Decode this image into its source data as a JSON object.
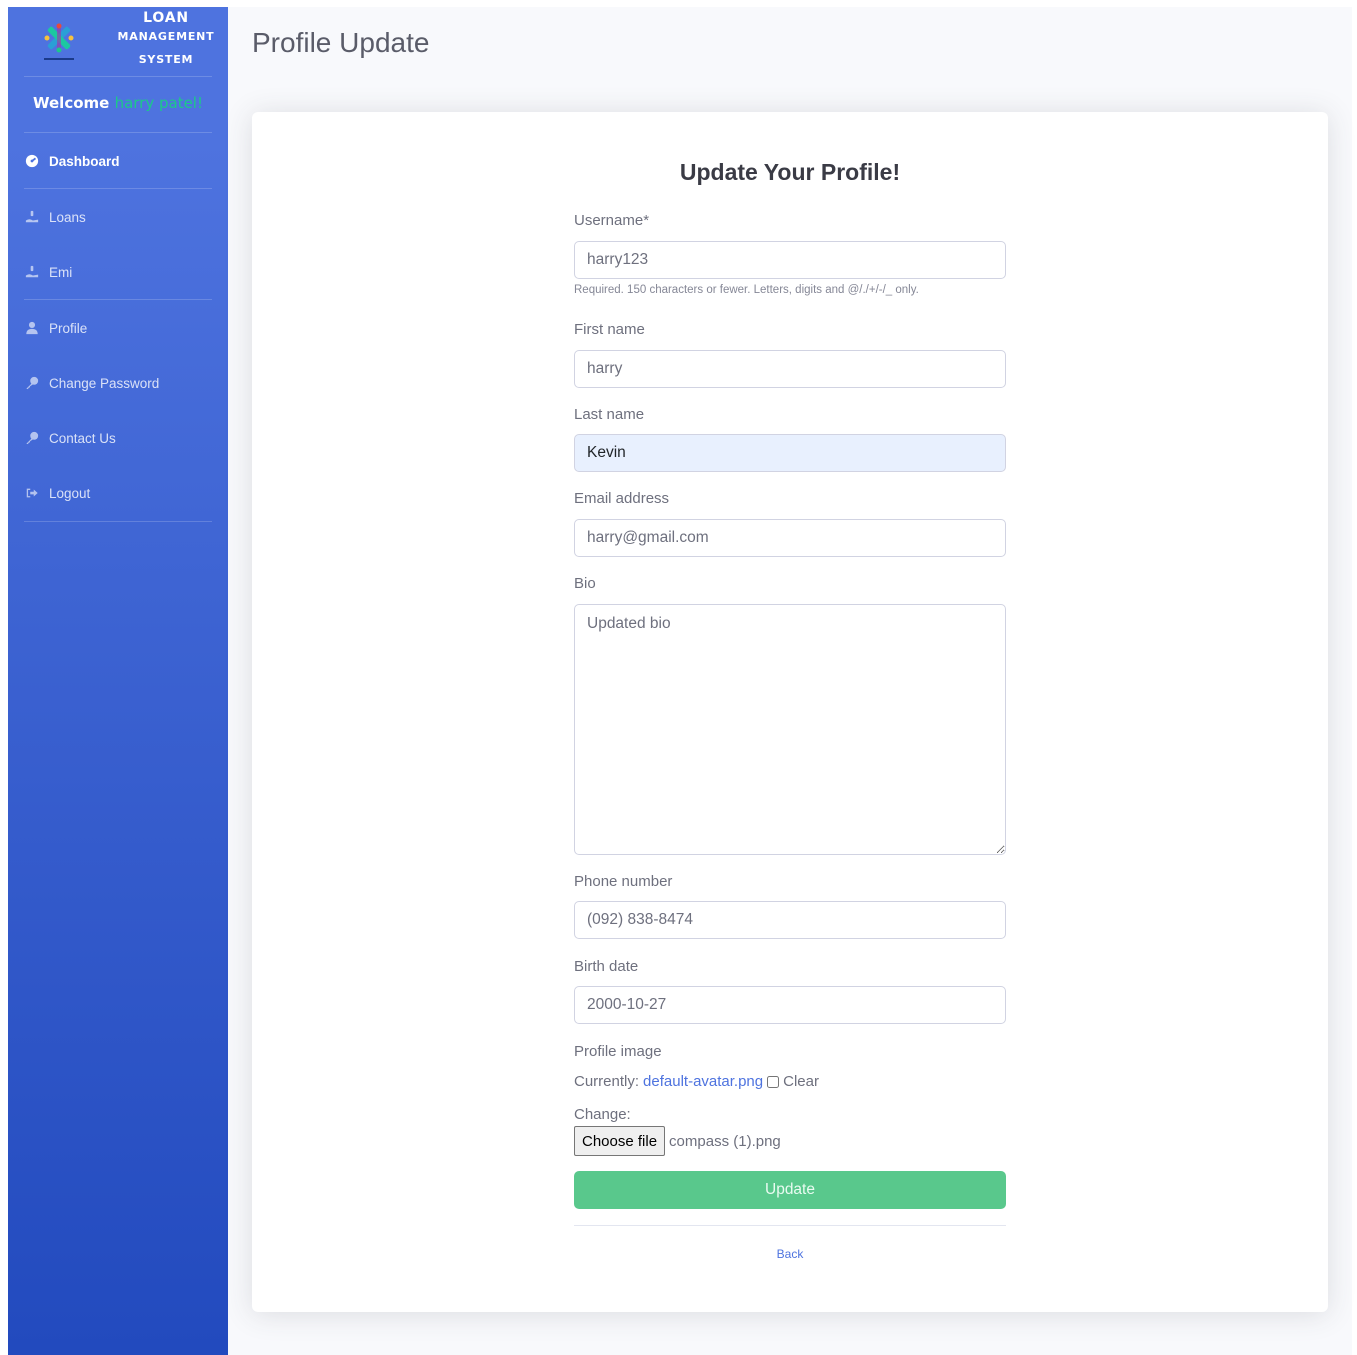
{
  "brand": {
    "line1": "LOAN",
    "line2": "MANAGEMENT",
    "line3": "SYSTEM",
    "logo_icon": "company-logo-icon"
  },
  "sidebar": {
    "welcome_label": "Welcome",
    "username": "harry patel!",
    "items": [
      {
        "label": "Dashboard",
        "icon": "tachometer-icon",
        "active": true
      },
      {
        "label": "Loans",
        "icon": "hand-holding-dollar-icon"
      },
      {
        "label": "Emi",
        "icon": "hand-holding-dollar-icon"
      },
      {
        "label": "Profile",
        "icon": "user-icon"
      },
      {
        "label": "Change Password",
        "icon": "key-icon"
      },
      {
        "label": "Contact Us",
        "icon": "key-icon"
      },
      {
        "label": "Logout",
        "icon": "sign-out-icon"
      }
    ]
  },
  "page": {
    "title": "Profile Update"
  },
  "form": {
    "heading": "Update Your Profile!",
    "username_label": "Username*",
    "username_value": "harry123",
    "username_help": "Required. 150 characters or fewer. Letters, digits and @/./+/-/_ only.",
    "first_name_label": "First name",
    "first_name_value": "harry",
    "last_name_label": "Last name",
    "last_name_value": "Kevin",
    "email_label": "Email address",
    "email_value": "harry@gmail.com",
    "bio_label": "Bio",
    "bio_value": "Updated bio",
    "phone_label": "Phone number",
    "phone_value": "(092) 838-8474",
    "birth_label": "Birth date",
    "birth_value": "2000-10-27",
    "image_label": "Profile image",
    "currently_label": "Currently:",
    "current_file": "default-avatar.png",
    "clear_label": "Clear",
    "change_label": "Change:",
    "choose_file_label": "Choose file",
    "chosen_file": "compass (1).png",
    "update_label": "Update",
    "back_label": "Back"
  },
  "colors": {
    "sidebar_top": "#4e73df",
    "sidebar_bottom": "#224abe",
    "accent": "#4e73df",
    "success": "#59c88c",
    "welcome_name": "#1cc88a"
  }
}
